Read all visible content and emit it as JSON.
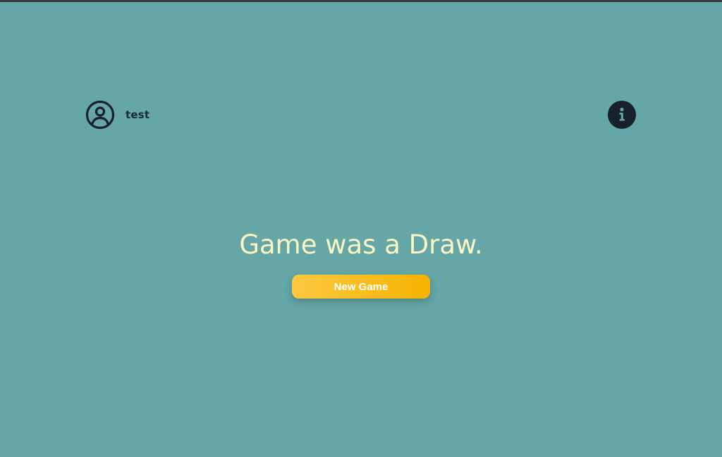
{
  "header": {
    "username": "test",
    "user_icon": "user-circle-icon",
    "info_icon": "info-icon"
  },
  "game": {
    "result_text": "Game was a Draw.",
    "new_game_label": "New Game"
  },
  "colors": {
    "background": "#64a7a6",
    "result_text": "#fbf6c4",
    "button_gradient_start": "#fcc840",
    "button_gradient_end": "#f6b300",
    "icon_dark": "#17212a"
  }
}
